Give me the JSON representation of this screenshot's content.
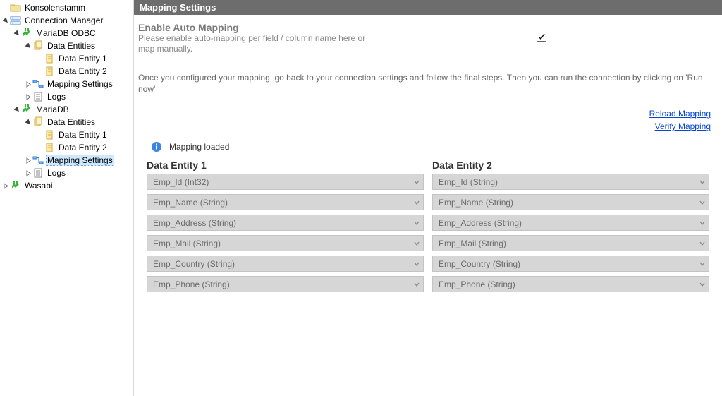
{
  "tree": [
    {
      "depth": 0,
      "exp": "none",
      "icon": "folder-open",
      "label": "Konsolenstamm",
      "sel": false,
      "int": true
    },
    {
      "depth": 0,
      "exp": "open",
      "icon": "conn-mgr",
      "label": "Connection Manager",
      "sel": false,
      "int": true
    },
    {
      "depth": 1,
      "exp": "open",
      "icon": "plug-green",
      "label": "MariaDB ODBC",
      "sel": false,
      "int": true
    },
    {
      "depth": 2,
      "exp": "open",
      "icon": "entities",
      "label": "Data Entities",
      "sel": false,
      "int": true
    },
    {
      "depth": 3,
      "exp": "none",
      "icon": "entity",
      "label": "Data Entity 1",
      "sel": false,
      "int": true
    },
    {
      "depth": 3,
      "exp": "none",
      "icon": "entity",
      "label": "Data Entity 2",
      "sel": false,
      "int": true
    },
    {
      "depth": 2,
      "exp": "closed",
      "icon": "mapping",
      "label": "Mapping Settings",
      "sel": false,
      "int": true
    },
    {
      "depth": 2,
      "exp": "closed",
      "icon": "logs",
      "label": "Logs",
      "sel": false,
      "int": true
    },
    {
      "depth": 1,
      "exp": "open",
      "icon": "plug-green",
      "label": "MariaDB",
      "sel": false,
      "int": true
    },
    {
      "depth": 2,
      "exp": "open",
      "icon": "entities",
      "label": "Data Entities",
      "sel": false,
      "int": true
    },
    {
      "depth": 3,
      "exp": "none",
      "icon": "entity",
      "label": "Data Entity 1",
      "sel": false,
      "int": true
    },
    {
      "depth": 3,
      "exp": "none",
      "icon": "entity",
      "label": "Data Entity 2",
      "sel": false,
      "int": true
    },
    {
      "depth": 2,
      "exp": "closed",
      "icon": "mapping",
      "label": "Mapping Settings",
      "sel": true,
      "int": true
    },
    {
      "depth": 2,
      "exp": "closed",
      "icon": "logs",
      "label": "Logs",
      "sel": false,
      "int": true
    },
    {
      "depth": 0,
      "exp": "closed",
      "icon": "plug-green",
      "label": "Wasabi",
      "sel": false,
      "int": true
    }
  ],
  "header": {
    "title": "Mapping Settings"
  },
  "enable_auto": {
    "title": "Enable Auto Mapping",
    "desc": "Please enable auto-mapping per field / column name here or map manually.",
    "checked": true
  },
  "instruction": "Once you configured your mapping, go back to your connection settings and follow the final steps. Then you can run the connection by clicking on 'Run now'",
  "links": {
    "reload": "Reload Mapping",
    "verify": "Verify Mapping"
  },
  "status": "Mapping loaded",
  "columns": {
    "left": {
      "heading": "Data Entity 1"
    },
    "right": {
      "heading": "Data Entity 2"
    }
  },
  "fields": [
    {
      "left": "Emp_Id (Int32)",
      "right": "Emp_Id (String)"
    },
    {
      "left": "Emp_Name (String)",
      "right": "Emp_Name (String)"
    },
    {
      "left": "Emp_Address (String)",
      "right": "Emp_Address (String)"
    },
    {
      "left": "Emp_Mail (String)",
      "right": "Emp_Mail (String)"
    },
    {
      "left": "Emp_Country (String)",
      "right": "Emp_Country (String)"
    },
    {
      "left": "Emp_Phone (String)",
      "right": "Emp_Phone (String)"
    }
  ]
}
